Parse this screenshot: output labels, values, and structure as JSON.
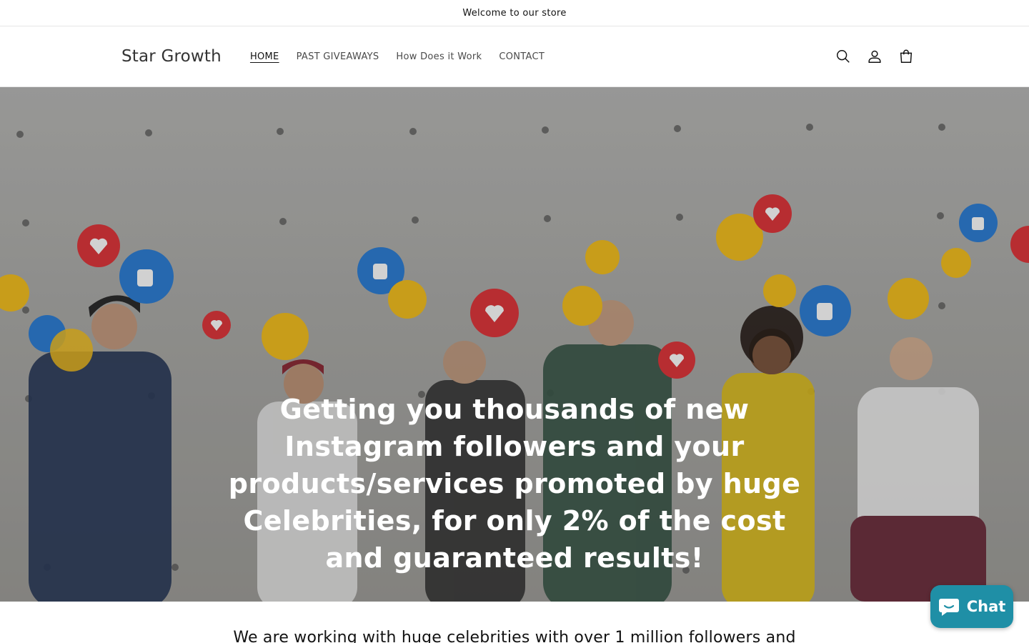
{
  "announcement": {
    "text": "Welcome to our store"
  },
  "header": {
    "logo": "Star Growth",
    "nav": [
      {
        "label": "HOME",
        "active": true
      },
      {
        "label": "PAST GIVEAWAYS",
        "active": false
      },
      {
        "label": "How Does it Work",
        "active": false
      },
      {
        "label": "CONTACT",
        "active": false
      }
    ],
    "icons": [
      "search-icon",
      "account-icon",
      "cart-icon"
    ]
  },
  "hero": {
    "text": "Getting you thousands of new Instagram followers and your products/services promoted by huge Celebrities, for only 2% of the cost and guaranteed results!"
  },
  "intro": {
    "text": "We are working with huge celebrities with over 1 million followers and"
  },
  "chat": {
    "label": "Chat",
    "color": "#1f8fa6"
  }
}
